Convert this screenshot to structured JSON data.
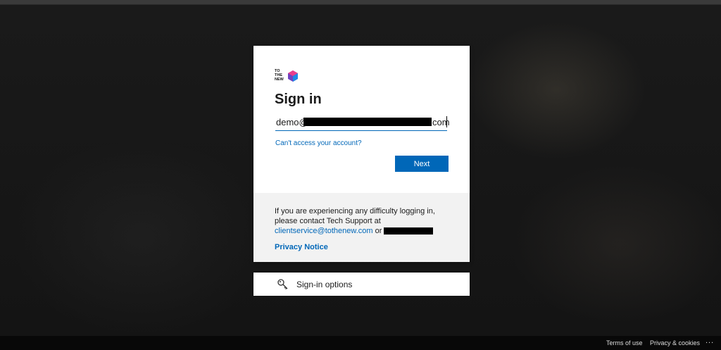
{
  "brand": {
    "logo_lines": [
      "TO",
      "THE",
      "NEW"
    ],
    "logo_colors": [
      "#e83e8c",
      "#6f42c1",
      "#1e88e5"
    ]
  },
  "signin": {
    "title": "Sign in",
    "email_prefix": "demo@",
    "email_suffix": "com",
    "cant_access": "Can't access your account?",
    "next_label": "Next"
  },
  "info": {
    "line1": "If you are experiencing any difficulty logging in, please contact Tech Support at",
    "email": "clientservice@tothenew.com",
    "or": "or",
    "privacy": "Privacy Notice"
  },
  "options": {
    "icon": "key-icon",
    "label": "Sign-in options"
  },
  "footer": {
    "terms": "Terms of use",
    "privacy_cookies": "Privacy & cookies",
    "more": "..."
  },
  "colors": {
    "accent": "#0067b8",
    "card_bg": "#ffffff",
    "info_bg": "#f2f2f2"
  }
}
